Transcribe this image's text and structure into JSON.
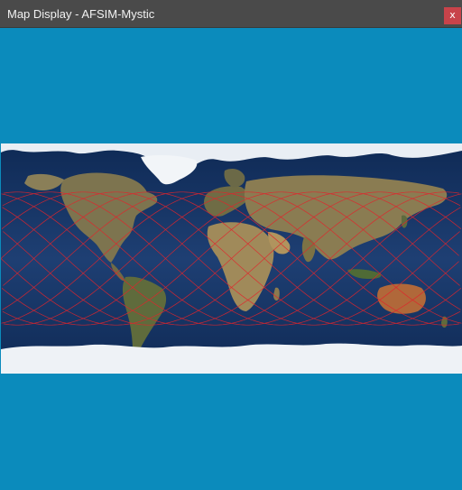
{
  "window": {
    "title": "Map Display - AFSIM-Mystic",
    "close_label": "x"
  },
  "map": {
    "projection": "equirectangular",
    "background": "satellite-earth-imagery",
    "ocean_color": "#1d3a6b",
    "ice_color": "#eef2f6",
    "land_color": "#7a6f4c",
    "track_color": "#e0252c",
    "track_type": "satellite-ground-track",
    "inclination_deg": 52
  }
}
